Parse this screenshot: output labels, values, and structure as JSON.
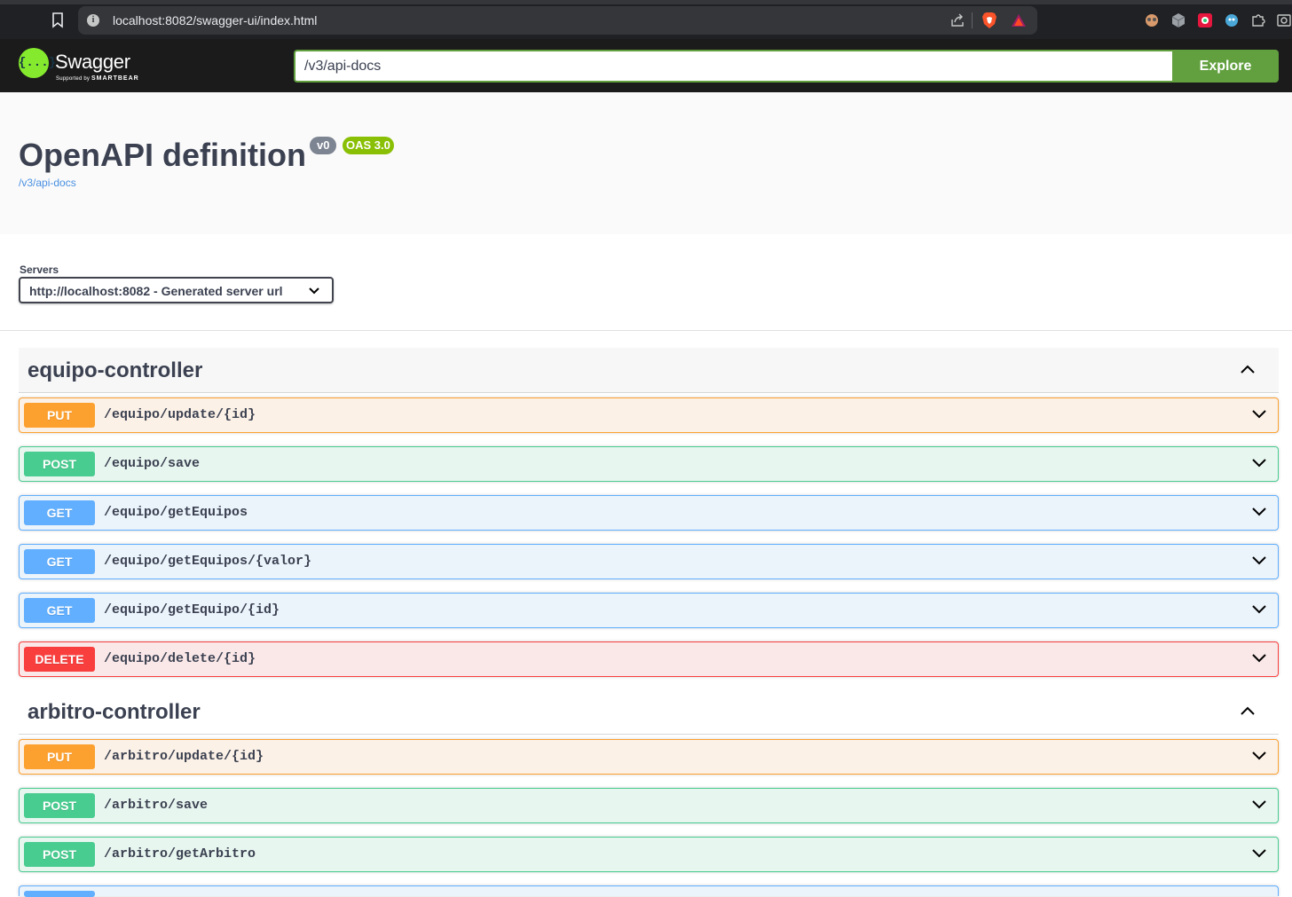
{
  "browser": {
    "url": "localhost:8082/swagger-ui/index.html"
  },
  "topbar": {
    "logo_name": "Swagger",
    "logo_sub_prefix": "Supported by",
    "logo_sub_brand": "SMARTBEAR",
    "logo_glyph": "{...}",
    "explore_input_value": "/v3/api-docs",
    "explore_label": "Explore"
  },
  "info": {
    "title": "OpenAPI definition",
    "version": "v0",
    "oas": "OAS 3.0",
    "spec_link": "/v3/api-docs"
  },
  "servers": {
    "label": "Servers",
    "selected": "http://localhost:8082 - Generated server url"
  },
  "tags": [
    {
      "name": "equipo-controller",
      "operations": [
        {
          "method": "PUT",
          "path": "/equipo/update/{id}"
        },
        {
          "method": "POST",
          "path": "/equipo/save"
        },
        {
          "method": "GET",
          "path": "/equipo/getEquipos"
        },
        {
          "method": "GET",
          "path": "/equipo/getEquipos/{valor}"
        },
        {
          "method": "GET",
          "path": "/equipo/getEquipo/{id}"
        },
        {
          "method": "DELETE",
          "path": "/equipo/delete/{id}"
        }
      ]
    },
    {
      "name": "arbitro-controller",
      "operations": [
        {
          "method": "PUT",
          "path": "/arbitro/update/{id}"
        },
        {
          "method": "POST",
          "path": "/arbitro/save"
        },
        {
          "method": "POST",
          "path": "/arbitro/getArbitro"
        }
      ]
    }
  ],
  "colors": {
    "put": "#fca130",
    "post": "#49cc90",
    "get": "#61affe",
    "delete": "#f93e3e",
    "brand_green": "#62a03f"
  }
}
